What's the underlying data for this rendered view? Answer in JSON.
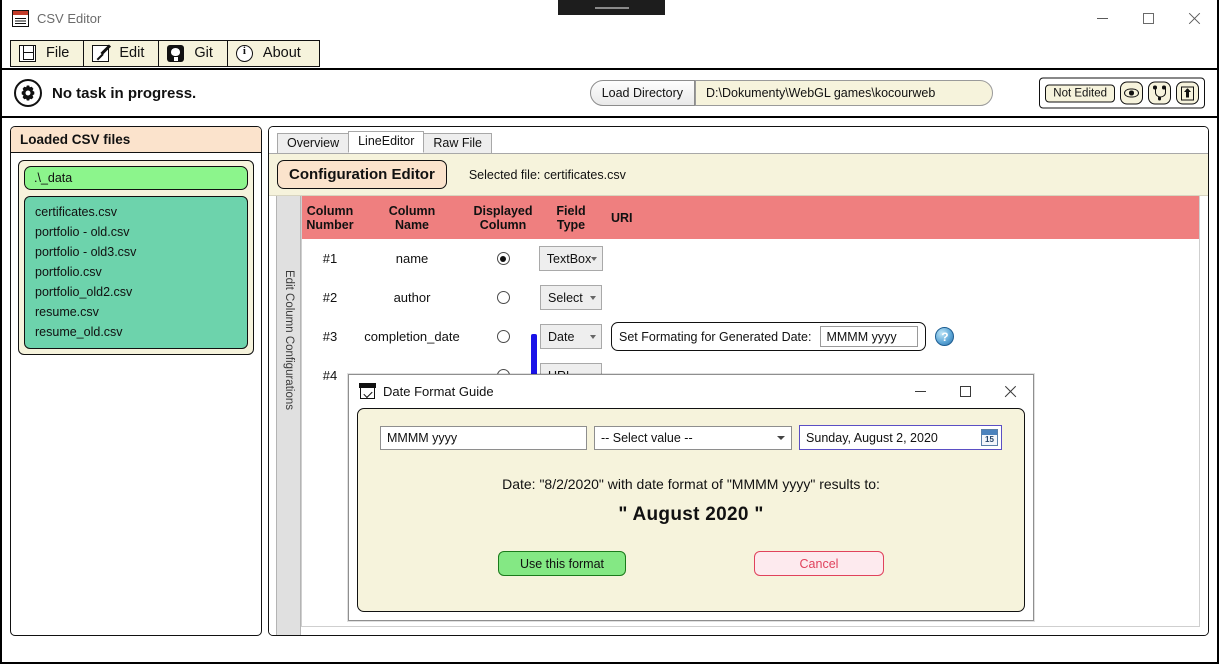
{
  "window": {
    "title": "CSV Editor",
    "icon": "csv-file-icon",
    "controls": {
      "minimize": "–",
      "maximize": "□",
      "close": "×"
    }
  },
  "menu": {
    "items": [
      {
        "label": "File",
        "icon": "save-icon"
      },
      {
        "label": "Edit",
        "icon": "pencil-icon"
      },
      {
        "label": "Git",
        "icon": "github-icon"
      },
      {
        "label": "About",
        "icon": "info-icon"
      }
    ]
  },
  "statusbar": {
    "icon": "gear-icon",
    "status_text": "No task in progress.",
    "load_directory_label": "Load Directory",
    "path_value": "D:\\Dokumenty\\WebGL games\\kocourweb",
    "edit_state_badge": "Not Edited",
    "tools": [
      {
        "icon": "eye-icon"
      },
      {
        "icon": "git-branch-icon"
      },
      {
        "icon": "commit-push-icon"
      }
    ]
  },
  "sidebar": {
    "header": "Loaded CSV files",
    "directory": ".\\_data",
    "files": [
      "certificates.csv",
      "portfolio - old.csv",
      "portfolio - old3.csv",
      "portfolio.csv",
      "portfolio_old2.csv",
      "resume.csv",
      "resume_old.csv"
    ]
  },
  "main": {
    "tabs": [
      {
        "label": "Overview",
        "active": false
      },
      {
        "label": "LineEditor",
        "active": true
      },
      {
        "label": "Raw File",
        "active": false
      }
    ],
    "config_button": "Configuration Editor",
    "selected_file_text": "Selected file: certificates.csv",
    "vertical_rail_label": "Edit Column Configurations",
    "table": {
      "headers": [
        "Column\nNumber",
        "Column\nName",
        "Displayed\nColumn",
        "Field\nType",
        "URI"
      ],
      "header_lines": {
        "h1a": "Column",
        "h1b": "Number",
        "h2a": "Column",
        "h2b": "Name",
        "h3a": "Displayed",
        "h3b": "Column",
        "h4a": "Field",
        "h4b": "Type",
        "h5": "URI"
      },
      "rows": [
        {
          "number": "#1",
          "name": "name",
          "displayed": true,
          "field_type": "TextBox",
          "uri": ""
        },
        {
          "number": "#2",
          "name": "author",
          "displayed": false,
          "field_type": "Select",
          "uri": ""
        },
        {
          "number": "#3",
          "name": "completion_date",
          "displayed": false,
          "field_type": "Date",
          "uri": "",
          "date_format_label": "Set Formating for Generated Date:",
          "date_format_value": "MMMM yyyy",
          "help_icon": "help-question-icon"
        },
        {
          "number": "#4",
          "name": "",
          "displayed": false,
          "field_type": "URL",
          "uri": ""
        }
      ]
    }
  },
  "dialog": {
    "icon": "calendar-check-icon",
    "title": "Date Format Guide",
    "controls": {
      "minimize": "–",
      "maximize": "□",
      "close": "×"
    },
    "format_input_value": "MMMM yyyy",
    "select_value": "-- Select value --",
    "date_value": "Sunday, August 2, 2020",
    "date_picker_icon_day": "15",
    "result_line": "Date: \"8/2/2020\" with date format of \"MMMM yyyy\" results to:",
    "result_value": "\"  August 2020  \"",
    "use_button": "Use this format",
    "cancel_button": "Cancel"
  },
  "colors": {
    "table_header_red": "#ef7f7f",
    "panel_cream": "#f6f3dc",
    "peach_header": "#fbe3cc",
    "dir_green": "#8cf58c",
    "file_list_teal": "#6dd3ac",
    "scrollbar_blue": "#1a12e8",
    "use_button_green": "#84e884",
    "cancel_red": "#e0425c"
  }
}
